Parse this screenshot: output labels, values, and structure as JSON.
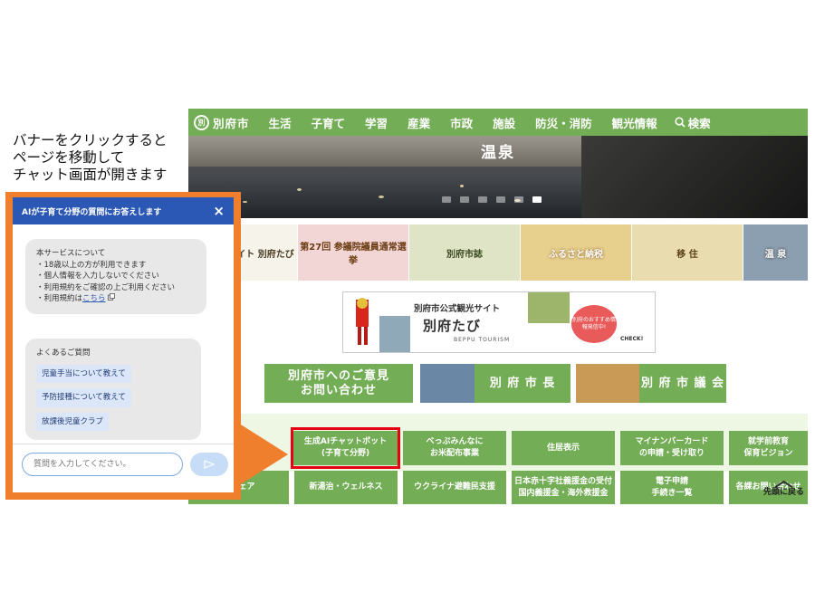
{
  "caption": [
    "バナーをクリックすると",
    "ページを移動して",
    "チャット画面が開きます"
  ],
  "site": {
    "logo_text": "別府市",
    "nav": [
      "生活",
      "子育て",
      "学習",
      "産業",
      "市政",
      "施設",
      "防災・消防",
      "観光情報"
    ],
    "search_label": "検索",
    "hero_title": "温泉",
    "banners": [
      "別府観光サイト 別府たび",
      "第27回 参議院議員通常選挙",
      "別府市誌",
      "ふるさと納税",
      "移 住",
      "温 泉"
    ],
    "tourism": {
      "title": "別府市公式観光サイト",
      "name": "別府たび",
      "sub": "BEPPU TOURISM",
      "badge": "別府のおすすめ情報発信中!",
      "check": "CHECK!"
    },
    "big_buttons": [
      "別府市へのご意見\nお問い合わせ",
      "別 府 市 長",
      "別 府 市 議 会"
    ],
    "row1": [
      "生成AIチャットボット\n(子育て分野)",
      "べっぷみんなに\nお米配布事業",
      "住居表示",
      "マイナンバーカード\nの申請・受け取り",
      "就学前教育\n保育ビジョン"
    ],
    "row2": [
      "ドシェア",
      "新湯治・ウェルネス",
      "ウクライナ避難民支援",
      "日本赤十字社義援金の受付\n国内義援金・海外救援金",
      "電子申請\n手続き一覧",
      "各課お問い合わせ"
    ],
    "page_top": "先頭に戻る"
  },
  "chat": {
    "header": "AIが子育て分野の質問にお答えします",
    "close": "×",
    "notice_lines": [
      "本サービスについて",
      "・18歳以上の方が利用できます",
      "・個人情報を入力しないでください",
      "・利用規約をご確認の上ご利用ください"
    ],
    "terms_prefix": "・利用規約は",
    "terms_link": "こちら",
    "faq_title": "よくあるご質問",
    "faq": [
      "児童手当について教えて",
      "予防接種について教えて",
      "放課後児童クラブ"
    ],
    "input_placeholder": "質問を入力してください。",
    "send_icon": "send-icon"
  },
  "colors": {
    "green": "#73ad55",
    "orange": "#f07f2d",
    "chat_blue": "#2b58b4",
    "highlight_red": "#e60012"
  }
}
